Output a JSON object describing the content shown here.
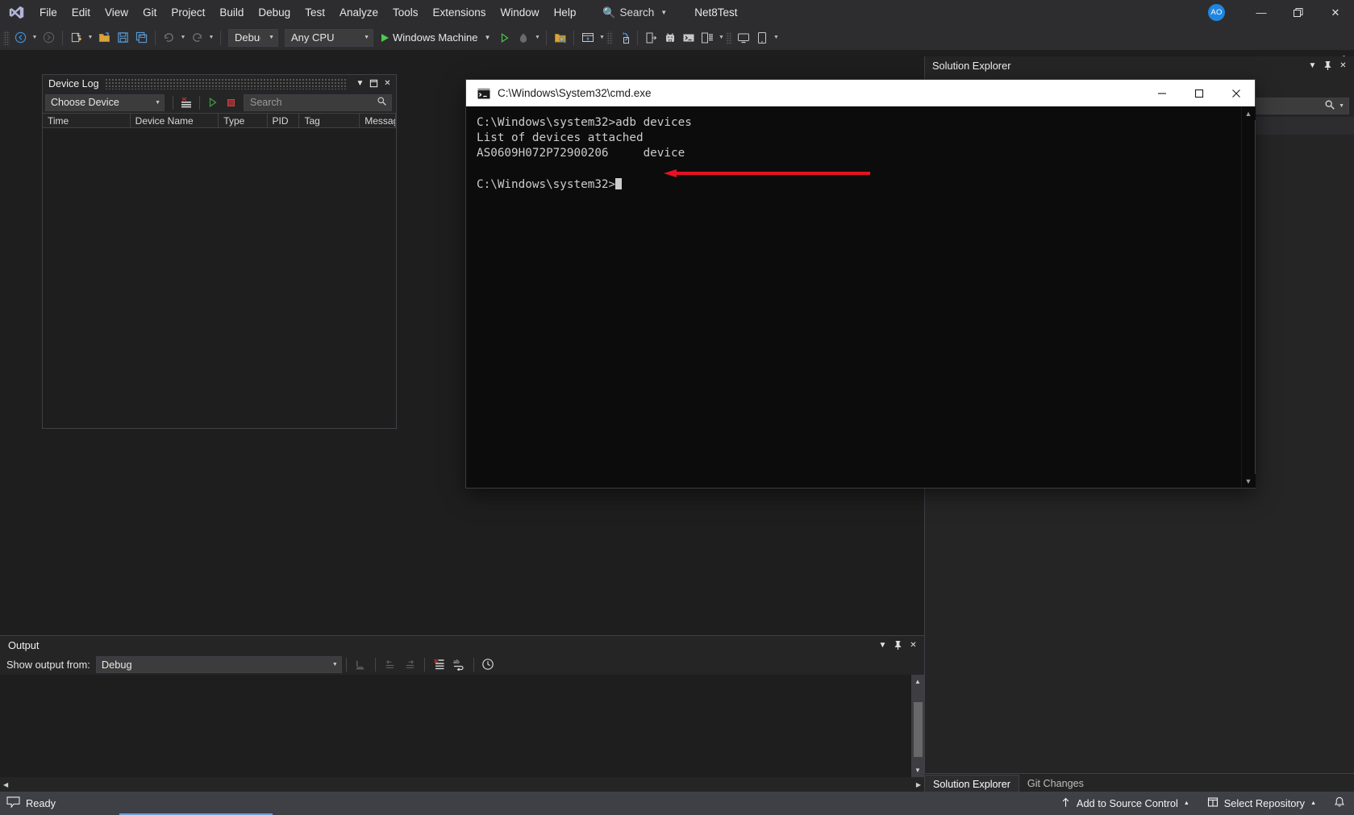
{
  "window": {
    "title_menu": [
      "File",
      "Edit",
      "View",
      "Git",
      "Project",
      "Build",
      "Debug",
      "Test",
      "Analyze",
      "Tools",
      "Extensions",
      "Window",
      "Help"
    ],
    "search_placeholder": "Search",
    "solution_name": "Net8Test",
    "avatar_initials": "AO",
    "minimize": "—",
    "restore": "❐",
    "close": "✕"
  },
  "toolbar": {
    "config_value": "Debug",
    "platform_value": "Any CPU",
    "run_target": "Windows Machine",
    "icons": [
      "navigate-backward-icon",
      "navigate-forward-icon",
      "new-project-icon",
      "open-file-icon",
      "save-icon",
      "save-all-icon",
      "undo-icon",
      "redo-icon",
      "start-debug-icon",
      "attach-icon",
      "find-in-files-icon",
      "android-device-manager-icon",
      "sync-icon",
      "device-deploy-icon",
      "android-sdk-icon",
      "android-adb-icon",
      "device-log-icon",
      "remote-machine-icon"
    ]
  },
  "device_log": {
    "title": "Device Log",
    "device_selector_value": "Choose Device",
    "search_placeholder": "Search",
    "columns": [
      "Time",
      "Device Name",
      "Type",
      "PID",
      "Tag",
      "Message"
    ],
    "rows": [],
    "buttons": {
      "clear": "clear-log-icon",
      "start": "start-log-icon",
      "stop": "stop-log-icon"
    }
  },
  "cmd": {
    "title": "C:\\Windows\\System32\\cmd.exe",
    "lines": [
      "C:\\Windows\\system32>adb devices",
      "List of devices attached",
      "AS0609H072P72900206     device",
      "",
      "C:\\Windows\\system32>"
    ],
    "annotation_color": "#e81123",
    "minimize": "—",
    "maximize": "☐",
    "close": "✕"
  },
  "solution_explorer": {
    "title": "Solution Explorer",
    "search_icon": "search-icon"
  },
  "output": {
    "title": "Output",
    "show_output_from_label": "Show output from:",
    "source_value": "Debug",
    "icons": [
      "find-message-icon",
      "go-to-previous-icon",
      "go-to-next-icon",
      "clear-all-icon",
      "toggle-word-wrap-icon",
      "show-timestamps-icon"
    ]
  },
  "bottom_tabs": [
    {
      "label": "Solution Explorer",
      "active": true
    },
    {
      "label": "Git Changes",
      "active": false
    }
  ],
  "status_bar": {
    "state": "Ready",
    "add_to_source_control": "Add to Source Control",
    "select_repository": "Select Repository",
    "notifications_icon": "bell-icon"
  },
  "colors": {
    "chrome": "#2d2d30",
    "panel": "#252526",
    "canvas": "#1e1e1e",
    "accent_blue": "#1f86e0",
    "status_bar": "#3f3f46",
    "annotation_red": "#e81123",
    "console_bg": "#0c0c0c",
    "console_fg": "#cccccc"
  }
}
